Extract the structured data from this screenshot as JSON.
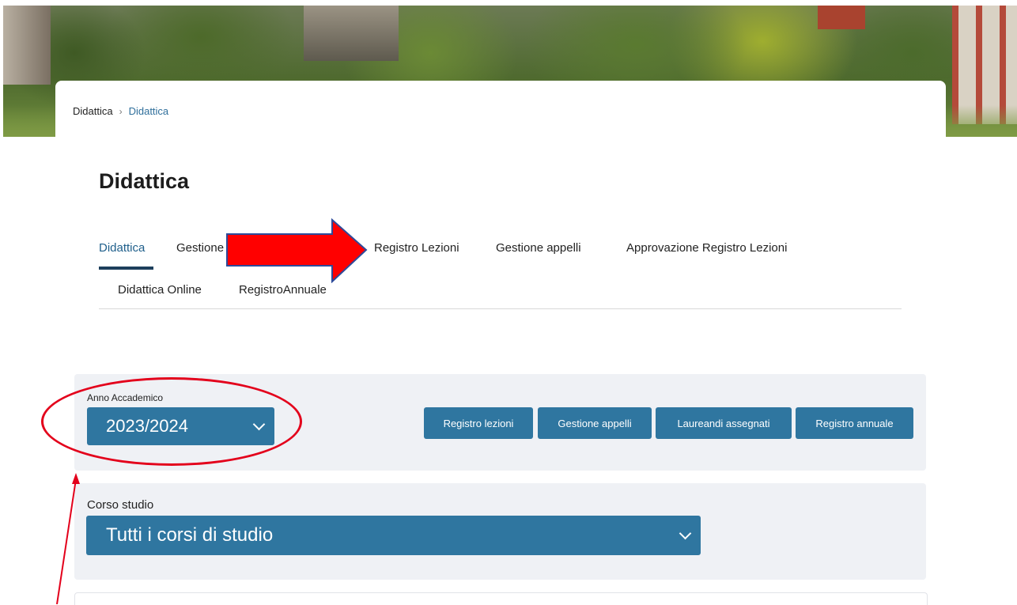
{
  "breadcrumb": {
    "parent": "Didattica",
    "separator": "›",
    "current": "Didattica"
  },
  "page": {
    "title": "Didattica"
  },
  "tabs": [
    {
      "label": "Didattica"
    },
    {
      "label": "Gestione"
    },
    {
      "label": "Registro Lezioni"
    },
    {
      "label": "Gestione appelli"
    },
    {
      "label": "Approvazione Registro Lezioni"
    },
    {
      "label": "Didattica Online"
    },
    {
      "label": "RegistroAnnuale"
    }
  ],
  "anno": {
    "label": "Anno Accademico",
    "value": "2023/2024"
  },
  "buttons": {
    "registro_lezioni": "Registro lezioni",
    "gestione_appelli": "Gestione appelli",
    "laureandi_assegnati": "Laureandi assegnati",
    "registro_annuale": "Registro annuale"
  },
  "corso": {
    "label": "Corso studio",
    "value": "Tutti i corsi di studio"
  },
  "colors": {
    "accent": "#2f76a0",
    "active_tab": "#1f5f8b",
    "annotation_red": "#e3001b",
    "panel_bg": "#eff1f5"
  }
}
